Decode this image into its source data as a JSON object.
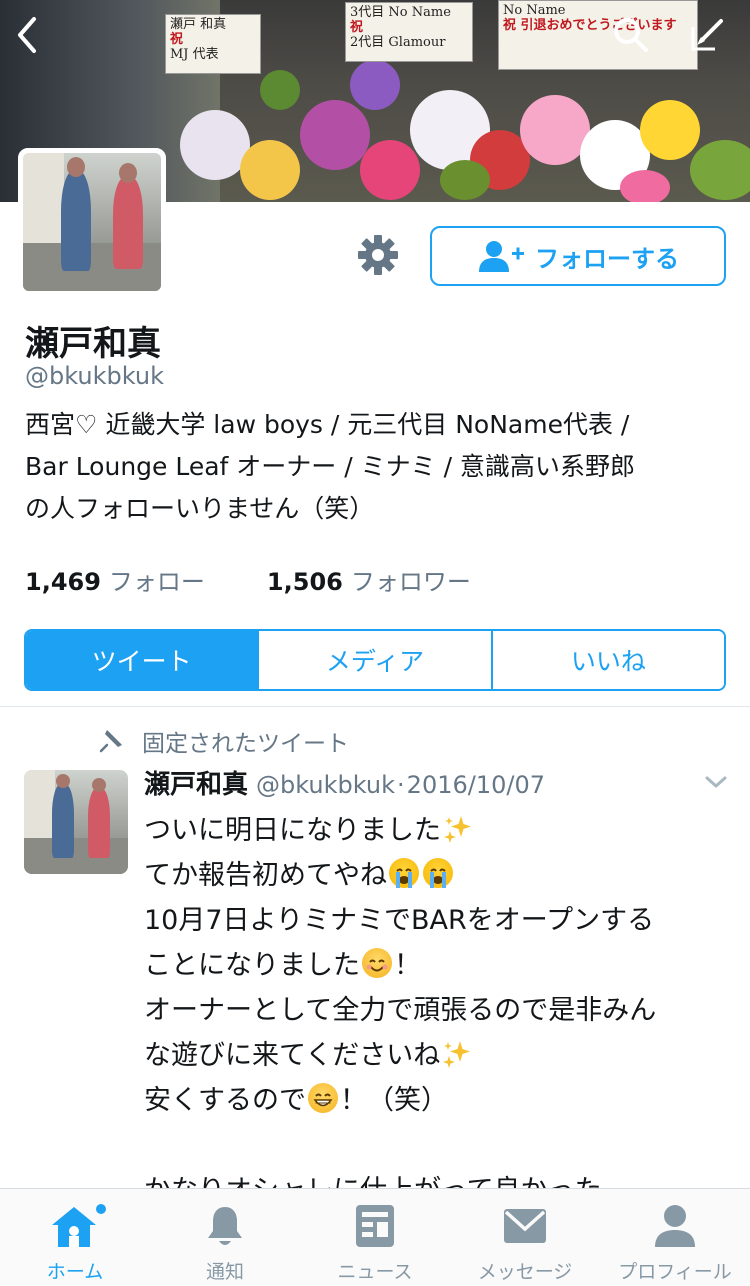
{
  "header": {
    "back_icon": "chevron-left-icon",
    "search_icon": "search-icon",
    "compose_icon": "compose-icon",
    "banner_signs": [
      {
        "line1": "瀬戸 和真",
        "line2": "MJ 代表"
      },
      {
        "line1": "3代目 No Name",
        "line2": "2代目 Glamour"
      },
      {
        "line1": "No Name",
        "line2": "祝 引退おめでとうございます"
      }
    ]
  },
  "profile": {
    "display_name": "瀬戸和真",
    "handle": "@bkukbkuk",
    "bio_lines": [
      "西宮♡ 近畿大学 law boys / 元三代目 NoName代表 /",
      "Bar Lounge Leaf オーナー / ミナミ / 意識高い系野郎",
      "の人フォローいりません（笑）"
    ],
    "follow_label": "フォローする",
    "settings_icon": "gear-icon",
    "following_count": "1,469",
    "following_label": "フォロー",
    "followers_count": "1,506",
    "followers_label": "フォロワー"
  },
  "tabs": [
    {
      "label": "ツイート",
      "active": true
    },
    {
      "label": "メディア",
      "active": false
    },
    {
      "label": "いいね",
      "active": false
    }
  ],
  "pinned_tweet": {
    "pinned_label": "固定されたツイート",
    "author_name": "瀬戸和真",
    "author_handle": "@bkukbkuk",
    "separator": "·",
    "date": "2016/10/07",
    "lines": [
      "ついに明日になりました",
      "てか報告初めてやね",
      "10月7日よりミナミでBARをオープンする",
      "ことになりました",
      "！",
      "オーナーとして全力で頑張るので是非みん",
      "な遊びに来てくださいね",
      "安くするので",
      "！（笑）",
      "かなりオシャレに仕上がって良かった"
    ]
  },
  "bottom_nav": [
    {
      "label": "ホーム",
      "icon": "home-icon",
      "active": true
    },
    {
      "label": "通知",
      "icon": "bell-icon",
      "active": false
    },
    {
      "label": "ニュース",
      "icon": "news-icon",
      "active": false
    },
    {
      "label": "メッセージ",
      "icon": "envelope-icon",
      "active": false
    },
    {
      "label": "プロフィール",
      "icon": "person-icon",
      "active": false
    }
  ],
  "colors": {
    "accent": "#1da1f2",
    "text": "#14171a",
    "muted": "#657786",
    "nav_inactive": "#8899a6"
  }
}
